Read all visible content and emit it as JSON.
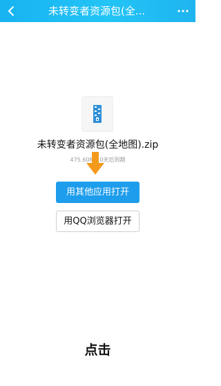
{
  "header": {
    "title": "未转变者资源包(全..."
  },
  "file": {
    "name": "未转变者资源包(全地图).zip",
    "meta_size": "475.60M",
    "meta_expiry": "0天后到期"
  },
  "actions": {
    "open_other_app": "用其他应用打开",
    "open_qq_browser": "用QQ浏览器打开"
  },
  "annotation": {
    "caption": "点击"
  },
  "colors": {
    "top_bar": "#17b3f2",
    "primary_button": "#1e9dec",
    "arrow": "#f39a1c"
  },
  "icons": {
    "back": "chevron-left-icon",
    "more": "more-dots-icon",
    "file": "zip-file-icon",
    "pointer": "down-arrow-icon"
  }
}
